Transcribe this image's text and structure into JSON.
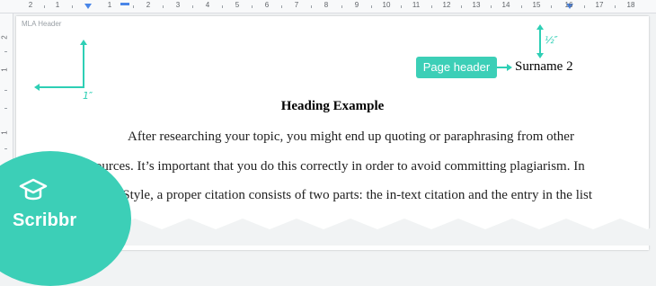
{
  "ruler": {
    "top_labels": [
      "2",
      "1",
      "1",
      "2",
      "3",
      "4",
      "5",
      "6",
      "7",
      "8",
      "9",
      "10",
      "11",
      "12",
      "13",
      "14",
      "15",
      "16",
      "17",
      "18"
    ],
    "left_labels": [
      "2",
      "1",
      "1"
    ]
  },
  "page": {
    "header_region_label": "MLA Header",
    "annotations": {
      "left_margin_label": "1″",
      "top_header_label": "½″",
      "page_header_badge": "Page header"
    },
    "running_head": "Surname 2",
    "heading": "Heading Example",
    "body_lines": [
      "After researching your topic, you might end up quoting or paraphrasing from other",
      "sources. It’s important that you do this correctly in order to avoid committing plagiarism. In",
      "MLA Style, a proper citation consists of two parts: the in-text citation and the entry in the list"
    ]
  },
  "brand": {
    "name": "Scribbr",
    "icon": "graduation-cap-icon",
    "color": "#3ccfb7"
  },
  "colors": {
    "accent": "#2ecfb5",
    "ruler_marker": "#4a86e8"
  }
}
